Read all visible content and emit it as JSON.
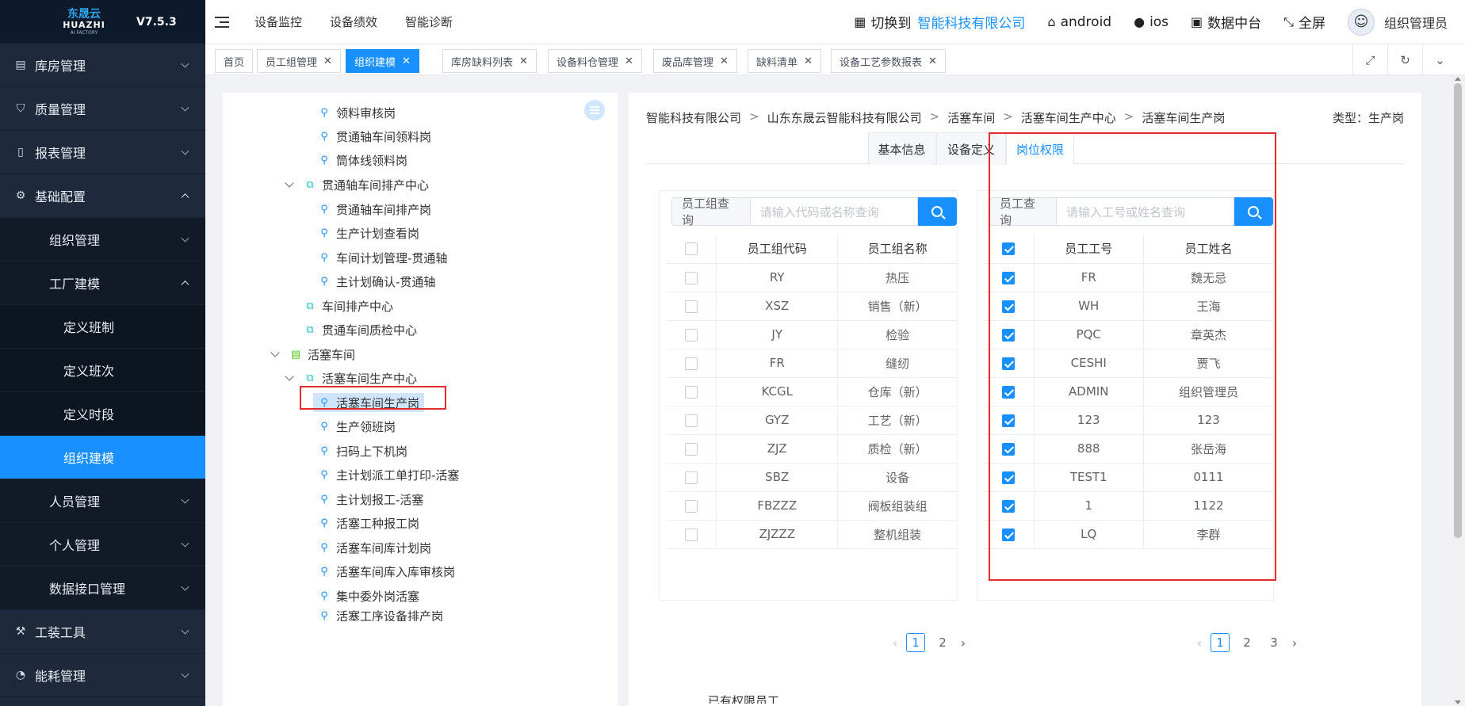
{
  "brand": {
    "cn": "东晟云",
    "en": "HUAZHI",
    "sub": "AI FACTORY",
    "version": "V7.5.3"
  },
  "header": {
    "nav": [
      "设备监控",
      "设备绩效",
      "智能诊断"
    ],
    "switch_label": "切换到",
    "company": "智能科技有限公司",
    "android": "android",
    "ios": "ios",
    "data_center": "数据中台",
    "fullscreen": "全屏",
    "user": "组织管理员"
  },
  "sidebar": {
    "items": [
      {
        "label": "库房管理",
        "icon": "warehouse-icon"
      },
      {
        "label": "质量管理",
        "icon": "shield-check-icon"
      },
      {
        "label": "报表管理",
        "icon": "report-book-icon"
      },
      {
        "label": "基础配置",
        "icon": "gear-icon"
      },
      {
        "label": "组织管理"
      },
      {
        "label": "工厂建模"
      },
      {
        "label": "定义班制"
      },
      {
        "label": "定义班次"
      },
      {
        "label": "定义时段"
      },
      {
        "label": "组织建模"
      },
      {
        "label": "人员管理"
      },
      {
        "label": "个人管理"
      },
      {
        "label": "数据接口管理"
      },
      {
        "label": "工装工具",
        "icon": "wrench-icon"
      },
      {
        "label": "能耗管理",
        "icon": "gauge-icon"
      }
    ]
  },
  "tabs": [
    {
      "label": "首页"
    },
    {
      "label": "员工组管理"
    },
    {
      "label": "组织建模"
    },
    {
      "label": "库房缺料列表"
    },
    {
      "label": "设备料仓管理"
    },
    {
      "label": "废品库管理"
    },
    {
      "label": "缺料清单"
    },
    {
      "label": "设备工艺参数报表"
    }
  ],
  "tree": {
    "nodes": [
      {
        "label": "领料审核岗"
      },
      {
        "label": "贯通轴车间领料岗"
      },
      {
        "label": "筒体线领料岗"
      },
      {
        "label": "贯通轴车间排产中心"
      },
      {
        "label": "贯通轴车间排产岗"
      },
      {
        "label": "生产计划查看岗"
      },
      {
        "label": "车间计划管理-贯通轴"
      },
      {
        "label": "主计划确认-贯通轴"
      },
      {
        "label": "车间排产中心"
      },
      {
        "label": "贯通车间质检中心"
      },
      {
        "label": "活塞车间"
      },
      {
        "label": "活塞车间生产中心"
      },
      {
        "label": "活塞车间生产岗"
      },
      {
        "label": "生产领班岗"
      },
      {
        "label": "扫码上下机岗"
      },
      {
        "label": "主计划派工单打印-活塞"
      },
      {
        "label": "主计划报工-活塞"
      },
      {
        "label": "活塞工种报工岗"
      },
      {
        "label": "活塞车间库计划岗"
      },
      {
        "label": "活塞车间库入库审核岗"
      },
      {
        "label": "集中委外岗活塞"
      },
      {
        "label": "活塞工序设备排产岗"
      }
    ]
  },
  "breadcrumb": [
    "智能科技有限公司",
    "山东东晟云智能科技有限公司",
    "活塞车间",
    "活塞车间生产中心",
    "活塞车间生产岗"
  ],
  "type_label": "类型：生产岗",
  "detail_tabs": [
    "基本信息",
    "设备定义",
    "岗位权限"
  ],
  "group_panel": {
    "search_label": "员工组查询",
    "placeholder": "请输入代码或名称查询",
    "columns": [
      "员工组代码",
      "员工组名称"
    ],
    "rows": [
      [
        "RY",
        "热压"
      ],
      [
        "XSZ",
        "销售（新）"
      ],
      [
        "JY",
        "检验"
      ],
      [
        "FR",
        "缝纫"
      ],
      [
        "KCGL",
        "仓库（新）"
      ],
      [
        "GYZ",
        "工艺（新）"
      ],
      [
        "ZJZ",
        "质检（新）"
      ],
      [
        "SBZ",
        "设备"
      ],
      [
        "FBZZZ",
        "阀板组装组"
      ],
      [
        "ZJZZZ",
        "整机组装"
      ]
    ],
    "pages": [
      "1",
      "2"
    ],
    "current_page": "1"
  },
  "employee_panel": {
    "search_label": "员工查询",
    "placeholder": "请输入工号或姓名查询",
    "columns": [
      "员工工号",
      "员工姓名"
    ],
    "rows": [
      [
        "FR",
        "魏无忌"
      ],
      [
        "WH",
        "王海"
      ],
      [
        "PQC",
        "章英杰"
      ],
      [
        "CESHI",
        "贾飞"
      ],
      [
        "ADMIN",
        "组织管理员"
      ],
      [
        "123",
        "123"
      ],
      [
        "888",
        "张岳海"
      ],
      [
        "TEST1",
        "0111"
      ],
      [
        "1",
        "1122"
      ],
      [
        "LQ",
        "李群"
      ]
    ],
    "pages": [
      "1",
      "2",
      "3"
    ],
    "current_page": "1"
  },
  "bottom_cut_text": "已有权限员工",
  "colors": {
    "primary": "#1890ff",
    "sidebar": "#1e2a3b",
    "highlight": "#e52b2b"
  }
}
